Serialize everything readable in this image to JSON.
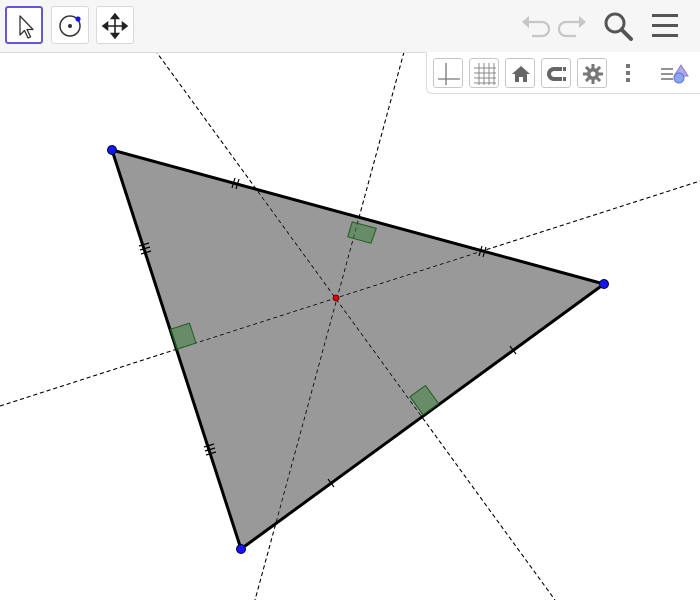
{
  "toolbar": {
    "tools": [
      {
        "name": "move-tool",
        "icon": "arrow-cursor-icon",
        "selected": true
      },
      {
        "name": "circle-tool",
        "icon": "circle-center-point-icon",
        "selected": false
      },
      {
        "name": "move-view-tool",
        "icon": "four-arrows-icon",
        "selected": false
      }
    ],
    "right_icons": [
      "undo-icon",
      "redo-icon",
      "search-icon",
      "menu-icon"
    ]
  },
  "style_bar": {
    "buttons": [
      "axes-icon",
      "grid-icon",
      "home-icon",
      "magnet-icon",
      "gear-icon",
      "more-vertical-icon",
      "algebra-view-toggle-icon"
    ]
  },
  "colors": {
    "accent": "#6557d2",
    "triangle_fill": "#999999",
    "vertex_point": "#1515ee",
    "circumcenter_point": "#dd0000",
    "right_angle_marker": "#007700"
  },
  "construction": {
    "vertices": 3,
    "perpendicular_bisectors": 3,
    "circumcenter": 1
  }
}
